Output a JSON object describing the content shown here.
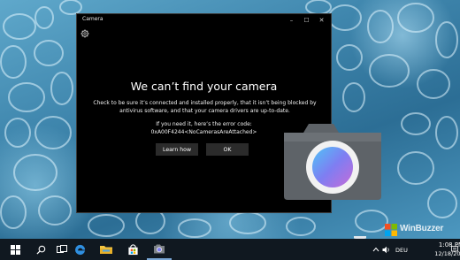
{
  "window": {
    "title": "Camera",
    "controls": {
      "minimize": "–",
      "maximize": "☐",
      "close": "✕"
    }
  },
  "error": {
    "title": "We can’t find your camera",
    "message": "Check to be sure it’s connected and installed properly, that it isn’t being blocked by antivirus software, and that your camera drivers are up-to-date.",
    "code_lead": "If you need it, here’s the error code:",
    "code": "0xA00F4244<NoCamerasAreAttached>",
    "learn_label": "Learn how",
    "ok_label": "OK"
  },
  "watermark": {
    "text": "WinBuzzer"
  },
  "taskbar": {
    "language": "DEU",
    "time": "1:08 PM",
    "date": "12/18/2015",
    "pinned": [
      "start-icon",
      "search-icon",
      "task-view-icon",
      "edge-icon",
      "file-explorer-icon",
      "store-icon"
    ]
  },
  "colors": {
    "accent": "#0078d7",
    "taskbar": "#101820",
    "button": "#2b2b2b"
  }
}
